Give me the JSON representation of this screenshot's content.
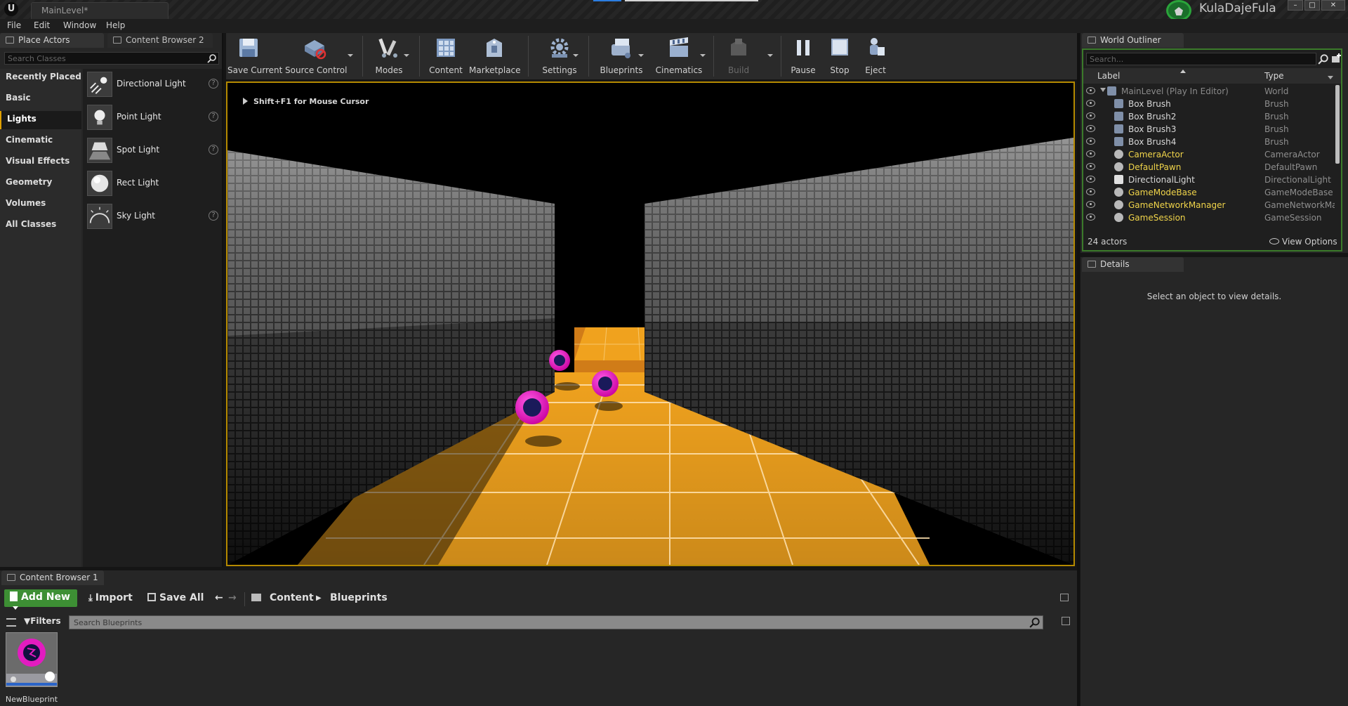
{
  "title_bar": {
    "document_tab": "MainLevel*",
    "project_name": "KulaDajeFula",
    "window_buttons": [
      "–",
      "□",
      "✕"
    ]
  },
  "menu": [
    "File",
    "Edit",
    "Window",
    "Help"
  ],
  "left_panel": {
    "tabs": [
      "Place Actors",
      "Content Browser 2"
    ],
    "search_placeholder": "Search Classes",
    "categories": [
      "Recently Placed",
      "Basic",
      "Lights",
      "Cinematic",
      "Visual Effects",
      "Geometry",
      "Volumes",
      "All Classes"
    ],
    "active_category": "Lights",
    "items": [
      "Directional Light",
      "Point Light",
      "Spot Light",
      "Rect Light",
      "Sky Light"
    ],
    "help_glyph": "?"
  },
  "toolbar": {
    "buttons": [
      {
        "label": "Save Current",
        "icon": "save-icon"
      },
      {
        "label": "Source Control",
        "icon": "source-control-icon"
      },
      {
        "label": "Modes",
        "icon": "modes-icon"
      },
      {
        "label": "Content",
        "icon": "content-icon"
      },
      {
        "label": "Marketplace",
        "icon": "marketplace-icon"
      },
      {
        "label": "Settings",
        "icon": "settings-icon"
      },
      {
        "label": "Blueprints",
        "icon": "blueprints-icon"
      },
      {
        "label": "Cinematics",
        "icon": "cinematics-icon"
      },
      {
        "label": "Build",
        "icon": "build-icon",
        "disabled": true
      },
      {
        "label": "Pause",
        "icon": "pause-icon"
      },
      {
        "label": "Stop",
        "icon": "stop-icon"
      },
      {
        "label": "Eject",
        "icon": "eject-icon"
      }
    ]
  },
  "viewport": {
    "hint": "Shift+F1 for Mouse Cursor",
    "colors": {
      "floor": "#f0a21e",
      "ball": "#ff1ed2",
      "border": "#b58a00"
    }
  },
  "world_outliner": {
    "tab": "World Outliner",
    "search_placeholder": "Search...",
    "columns": [
      "Label",
      "Type"
    ],
    "rows": [
      {
        "label": "MainLevel (Play In Editor)",
        "type": "World",
        "kind": "world"
      },
      {
        "label": "Box Brush",
        "type": "Brush",
        "kind": "brush"
      },
      {
        "label": "Box Brush2",
        "type": "Brush",
        "kind": "brush"
      },
      {
        "label": "Box Brush3",
        "type": "Brush",
        "kind": "brush"
      },
      {
        "label": "Box Brush4",
        "type": "Brush",
        "kind": "brush"
      },
      {
        "label": "CameraActor",
        "type": "CameraActor",
        "kind": "actor"
      },
      {
        "label": "DefaultPawn",
        "type": "DefaultPawn",
        "kind": "actor"
      },
      {
        "label": "DirectionalLight",
        "type": "DirectionalLight",
        "kind": "light"
      },
      {
        "label": "GameModeBase",
        "type": "GameModeBase",
        "kind": "actor"
      },
      {
        "label": "GameNetworkManager",
        "type": "GameNetworkMar",
        "kind": "actor"
      },
      {
        "label": "GameSession",
        "type": "GameSession",
        "kind": "actor"
      }
    ],
    "actor_count": "24 actors",
    "view_options": "View Options"
  },
  "details": {
    "tab": "Details",
    "message": "Select an object to view details."
  },
  "content_browser": {
    "tab": "Content Browser 1",
    "add_new": "Add New",
    "import": "Import",
    "save_all": "Save All",
    "path": [
      "Content",
      "Blueprints"
    ],
    "filters": "Filters",
    "search_placeholder": "Search Blueprints",
    "assets": [
      {
        "name": "NewBlueprint"
      }
    ]
  }
}
